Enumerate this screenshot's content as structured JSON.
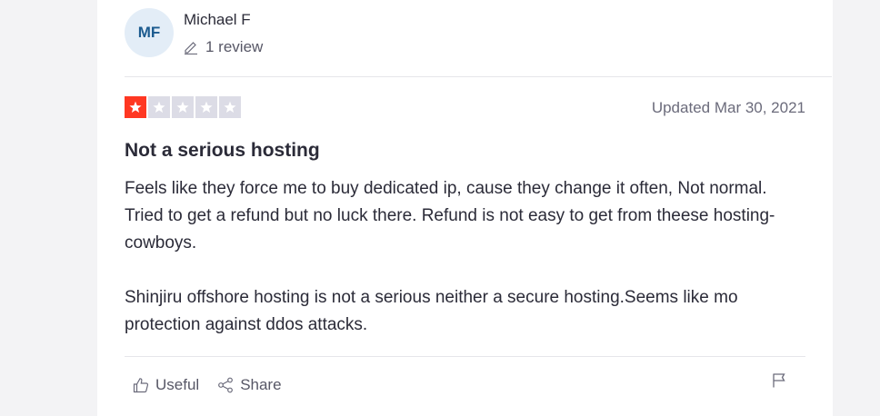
{
  "consumer": {
    "initials": "MF",
    "name": "Michael F",
    "review_count": "1 review"
  },
  "review": {
    "rating": 1,
    "rating_max": 5,
    "date": "Updated Mar 30, 2021",
    "title": "Not a serious hosting",
    "paragraphs": [
      "Feels like they force me to buy dedicated ip, cause they change it often, Not normal. Tried to get a refund but no luck there. Refund is not easy to get from theese hosting-cowboys.",
      "Shinjiru offshore hosting is not a serious neither a secure hosting.Seems like mo protection against ddos attacks."
    ]
  },
  "actions": {
    "useful_label": "Useful",
    "share_label": "Share"
  },
  "icons": {
    "pencil": "pencil-icon",
    "thumbs_up": "thumbs-up-icon",
    "share": "share-icon",
    "flag": "flag-icon",
    "star": "star-icon"
  },
  "colors": {
    "star_active": "#ff3722",
    "star_inactive": "#dcdce6",
    "avatar_bg": "#e3edf7",
    "avatar_text": "#1c5b8f"
  }
}
